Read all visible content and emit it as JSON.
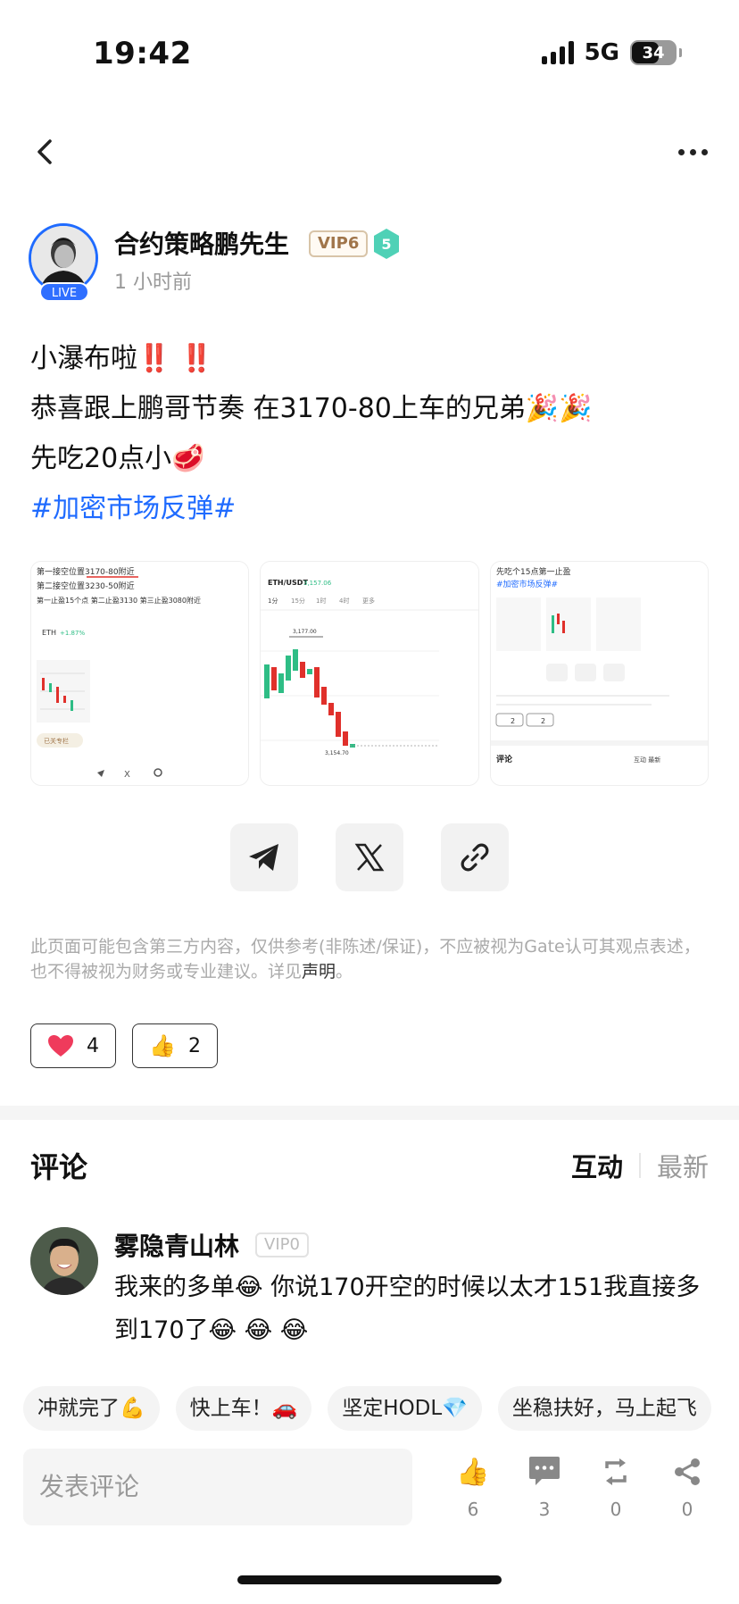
{
  "status_bar": {
    "time": "19:42",
    "network": "5G",
    "battery": "34"
  },
  "author": {
    "name": "合约策略鹏先生",
    "vip": "VIP6",
    "level": "5",
    "live": "LIVE",
    "time": "1 小时前"
  },
  "post": {
    "lines": [
      "小瀑布啦",
      "恭喜跟上鹏哥节奏 在3170-80上车的兄弟",
      "先吃20点小"
    ],
    "emojis": {
      "bangs": "‼️ ‼️",
      "party": "🎉🎉",
      "meat": "🥩"
    },
    "hashtag": "#加密市场反弹#"
  },
  "images": {
    "img1": {
      "line1": "第一接空位置3170-80附近",
      "line2": "第二接空位置3230-50附近",
      "line3": "第一止盈15个点 第二止盈3130 第三止盈3080附近",
      "ticker": "ETH",
      "pct": "+1.87%",
      "tag": "已关专栏"
    },
    "img2": {
      "pair": "ETH/USDT",
      "price": "3,157.06",
      "tabs": [
        "1分",
        "15分",
        "1时",
        "4时",
        "更多"
      ],
      "high": "3,177.00",
      "low": "3,154.70"
    },
    "img3": {
      "title": "先吃个15点第一止盈",
      "hashtag": "#加密市场反弹#",
      "likes": "2",
      "thumbs": "2",
      "footer_left": "评论",
      "footer_right": "互动  最新"
    }
  },
  "disclaimer": {
    "text": "此页面可能包含第三方内容，仅供参考(非陈述/保证)，不应被视为Gate认可其观点表述，也不得被视为财务或专业建议。详见",
    "link": "声明",
    "end": "。"
  },
  "reactions": {
    "heart_count": "4",
    "thumb_count": "2"
  },
  "comments_header": {
    "title": "评论",
    "tab_active": "互动",
    "tab_inactive": "最新"
  },
  "comment": {
    "name": "雾隐青山林",
    "vip": "VIP0",
    "text": "我来的多单😂 你说170开空的时候以太才151我直接多到170了😂 😂 😂"
  },
  "quick_replies": [
    "冲就完了💪",
    "快上车！🚗",
    "坚定HODL💎",
    "坐稳扶好，马上起飞"
  ],
  "bottom_bar": {
    "placeholder": "发表评论",
    "likes": "6",
    "comments": "3",
    "reposts": "0",
    "shares": "0"
  },
  "colors": {
    "accent": "#1f6bff",
    "red": "#e0302b",
    "green": "#2ebd85"
  }
}
